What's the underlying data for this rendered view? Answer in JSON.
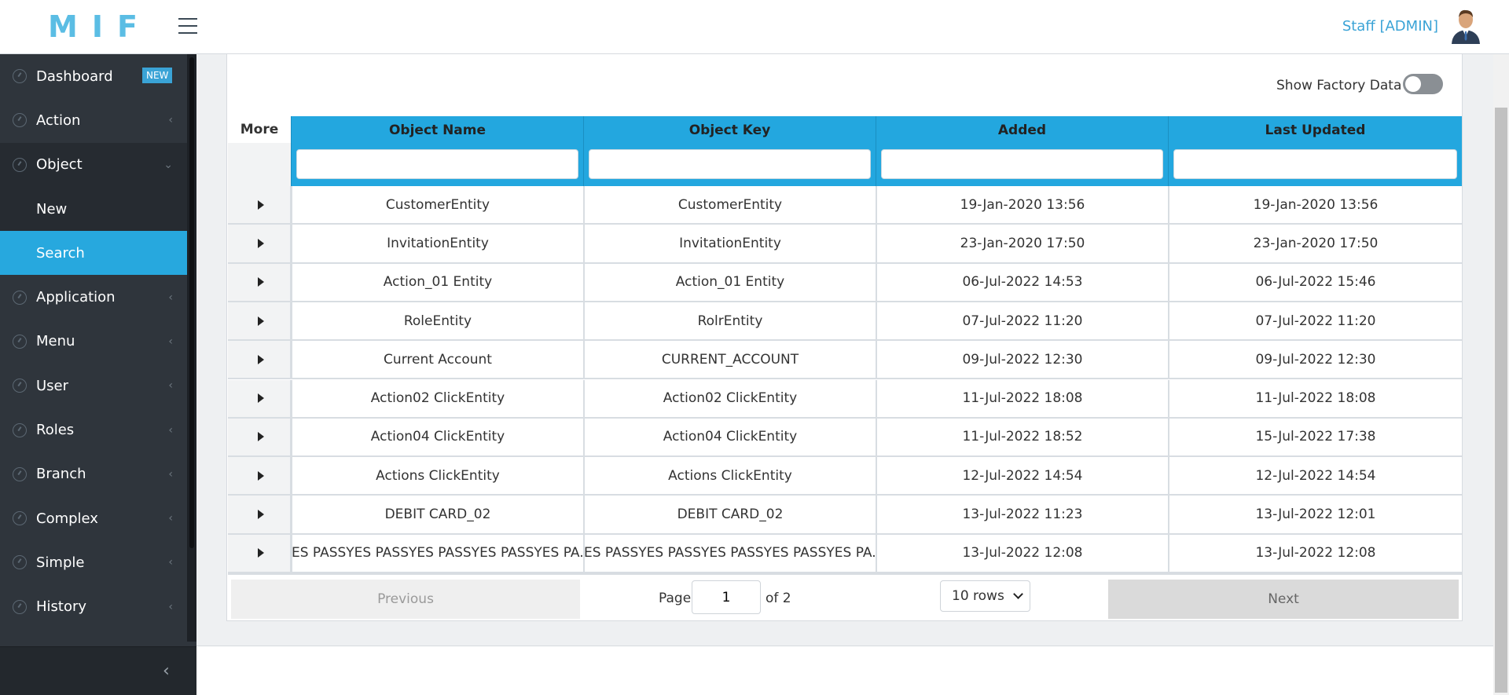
{
  "header": {
    "logo": "MIF",
    "user": "Staff [ADMIN]"
  },
  "sidebar": {
    "items": [
      {
        "label": "Dashboard",
        "badge": "NEW"
      },
      {
        "label": "Action"
      },
      {
        "label": "Object",
        "open": true
      },
      {
        "label": "New",
        "sub": true
      },
      {
        "label": "Search",
        "sub": true,
        "active": true
      },
      {
        "label": "Application"
      },
      {
        "label": "Menu"
      },
      {
        "label": "User"
      },
      {
        "label": "Roles"
      },
      {
        "label": "Branch"
      },
      {
        "label": "Complex"
      },
      {
        "label": "Simple"
      },
      {
        "label": "History"
      }
    ]
  },
  "panel": {
    "factory_label": "Show Factory Data"
  },
  "table": {
    "more_header": "More",
    "columns": [
      "Object Name",
      "Object Key",
      "Added",
      "Last Updated"
    ],
    "rows": [
      [
        "CustomerEntity",
        "CustomerEntity",
        "19-Jan-2020 13:56",
        "19-Jan-2020 13:56"
      ],
      [
        "InvitationEntity",
        "InvitationEntity",
        "23-Jan-2020 17:50",
        "23-Jan-2020 17:50"
      ],
      [
        "Action_01 Entity",
        "Action_01 Entity",
        "06-Jul-2022 14:53",
        "06-Jul-2022 15:46"
      ],
      [
        "RoleEntity",
        "RolrEntity",
        "07-Jul-2022 11:20",
        "07-Jul-2022 11:20"
      ],
      [
        "Current Account",
        "CURRENT_ACCOUNT",
        "09-Jul-2022 12:30",
        "09-Jul-2022 12:30"
      ],
      [
        "Action02 ClickEntity",
        "Action02 ClickEntity",
        "11-Jul-2022 18:08",
        "11-Jul-2022 18:08"
      ],
      [
        "Action04 ClickEntity",
        "Action04 ClickEntity",
        "11-Jul-2022 18:52",
        "15-Jul-2022 17:38"
      ],
      [
        "Actions ClickEntity",
        "Actions ClickEntity",
        "12-Jul-2022 14:54",
        "12-Jul-2022 14:54"
      ],
      [
        "DEBIT CARD_02",
        "DEBIT CARD_02",
        "13-Jul-2022 11:23",
        "13-Jul-2022 12:01"
      ],
      [
        "YES PASSYES PASSYES PASSYES PASSYES PA...",
        "YES PASSYES PASSYES PASSYES PASSYES PA...",
        "13-Jul-2022 12:08",
        "13-Jul-2022 12:08"
      ]
    ]
  },
  "pager": {
    "previous": "Previous",
    "page_label": "Page",
    "page_value": "1",
    "of_label": "of 2",
    "rows_option": "10 rows",
    "next": "Next"
  }
}
